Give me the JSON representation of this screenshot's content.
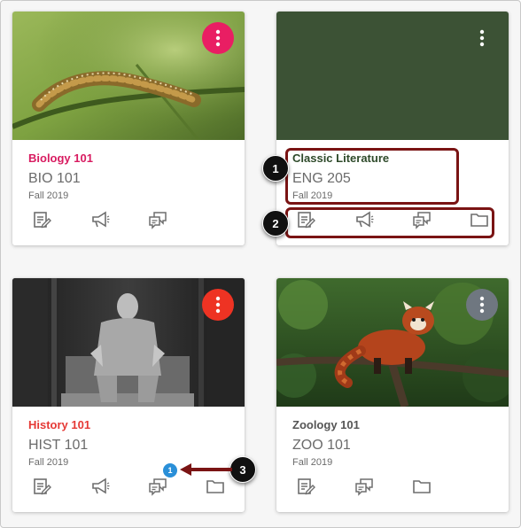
{
  "courses": [
    {
      "name": "Biology 101",
      "code": "BIO 101",
      "term": "Fall 2019",
      "name_color": "#d81b60",
      "menu_color": "#e91e63",
      "image": "caterpillar-photo",
      "actions": [
        "assignments-icon",
        "announcements-icon",
        "discussions-icon"
      ]
    },
    {
      "name": "Classic Literature",
      "code": "ENG 205",
      "term": "Fall 2019",
      "name_color": "#2e4a2a",
      "hero_color": "#3c5235",
      "actions": [
        "assignments-icon",
        "announcements-icon",
        "discussions-icon",
        "files-icon"
      ]
    },
    {
      "name": "History 101",
      "code": "HIST 101",
      "term": "Fall 2019",
      "name_color": "#e53935",
      "menu_color": "#ee3323",
      "image": "lincoln-memorial-photo",
      "actions": [
        "assignments-icon",
        "announcements-icon",
        "discussions-icon",
        "files-icon"
      ],
      "discussion_badge": "1"
    },
    {
      "name": "Zoology 101",
      "code": "ZOO 101",
      "term": "Fall 2019",
      "name_color": "#555555",
      "menu_color": "#6f7780",
      "image": "red-panda-photo",
      "actions": [
        "assignments-icon",
        "discussions-icon",
        "files-icon"
      ]
    }
  ],
  "callouts": {
    "one": "1",
    "two": "2",
    "three": "3",
    "color": "#7a1414"
  }
}
